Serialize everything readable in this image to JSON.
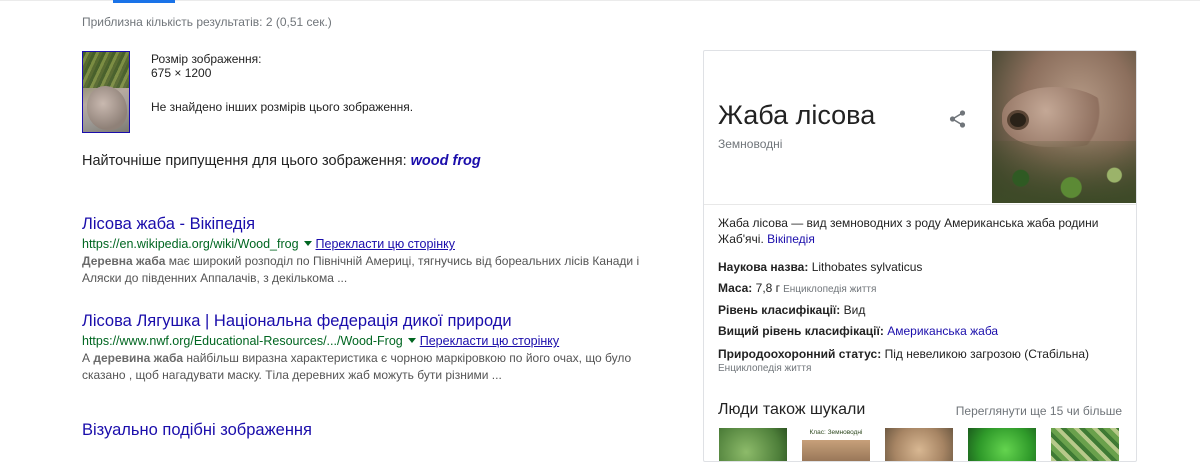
{
  "stats": "Приблизна кількість результатів: 2 (0,51 сек.)",
  "image_info": {
    "size_label": "Розмір зображення:",
    "size_value": "675 × 1200",
    "no_other_sizes": "Не знайдено інших розмірів цього зображення."
  },
  "best_guess": {
    "label": "Найточніше припущення для цього зображення:",
    "query": "wood frog"
  },
  "results": [
    {
      "title": "Лісова жаба - Вікіпедія",
      "url": "https://en.wikipedia.org/wiki/Wood_frog",
      "translate": "Перекласти цю сторінку",
      "snippet_bold": "Деревна жаба",
      "snippet_rest": " має широкий розподіл по Північній Америці, тягнучись від бореальних лісів Канади і Аляски до південних Аппалачів, з декількома ..."
    },
    {
      "title": "Лісова Лягушка | Національна федерація дикої природи",
      "url": "https://www.nwf.org/Educational-Resources/.../Wood-Frog",
      "translate": "Перекласти цю сторінку",
      "snippet_pre": "А ",
      "snippet_bold": "деревина жаба",
      "snippet_rest": " найбільш виразна характеристика є чорною маркіровкою по його очах, що було сказано , щоб нагадувати маску. Тіла деревних жаб можуть бути різними ..."
    }
  ],
  "similar_images": "Візуально подібні зображення",
  "knowledge_panel": {
    "title": "Жаба лісова",
    "subtitle": "Земноводні",
    "description": "Жаба лісова — вид земноводних з роду Американська жаба родини Жаб'ячі.",
    "description_link": "Вікіпедія",
    "facts": [
      {
        "label": "Наукова назва:",
        "value": "Lithobates sylvaticus",
        "source": ""
      },
      {
        "label": "Маса:",
        "value": "7,8 г",
        "source": "Енциклопедія життя"
      },
      {
        "label": "Рівень класифікації:",
        "value": "Вид",
        "source": ""
      },
      {
        "label": "Вищий рівень класифікації:",
        "link": "Американська жаба"
      },
      {
        "label": "Природоохоронний статус:",
        "value": "Під невеликою загрозою (Стабільна)",
        "source": ""
      }
    ],
    "status_source": "Енциклопедія життя",
    "people_also_search": "Люди також шукали",
    "view_more": "Переглянути ще 15 чи більше",
    "tile_label": "Клас: Земноводні"
  },
  "colors": {
    "link": "#1a0dab",
    "url_green": "#006621",
    "meta_gray": "#70757a"
  }
}
